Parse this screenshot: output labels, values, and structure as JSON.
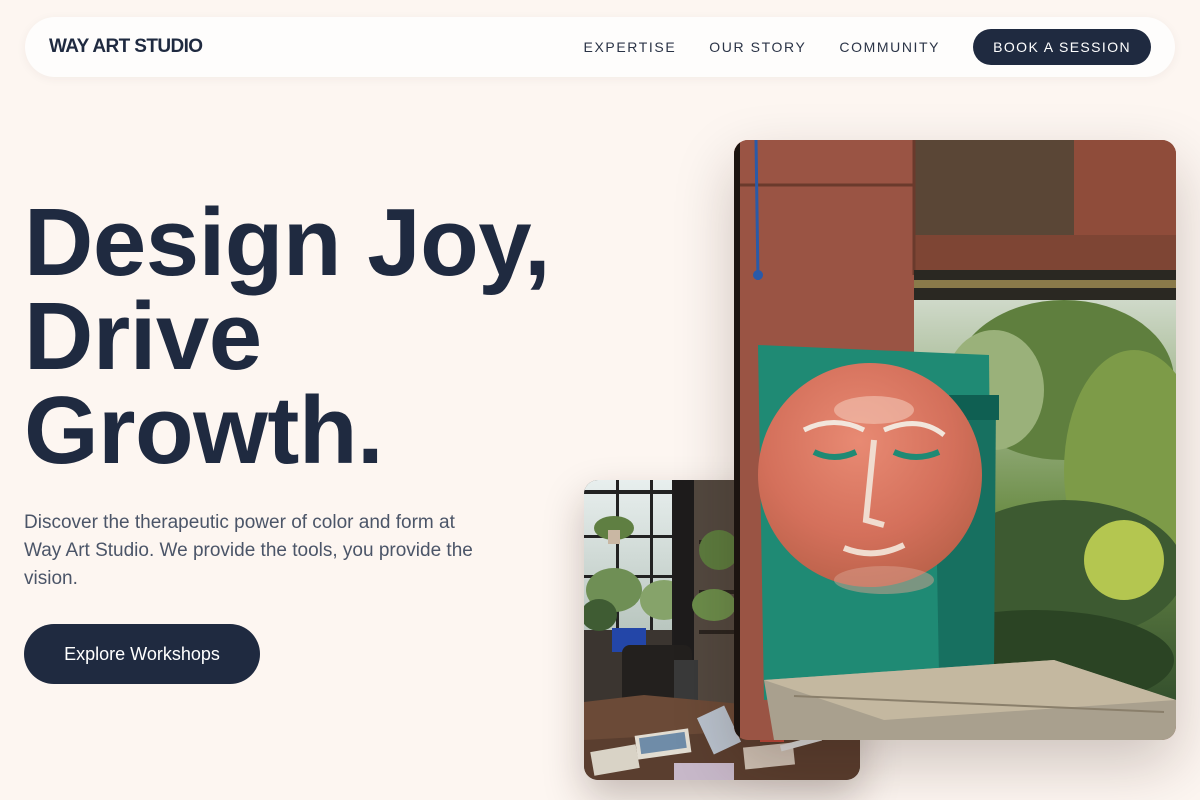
{
  "nav": {
    "logo": "WAY ART STUDIO",
    "links": [
      {
        "label": "EXPERTISE"
      },
      {
        "label": "OUR STORY"
      },
      {
        "label": "COMMUNITY"
      }
    ],
    "cta_label": "BOOK A SESSION"
  },
  "hero": {
    "headline_lines": [
      "Design Joy,",
      "Drive",
      "Growth."
    ],
    "lead": "Discover the therapeutic power of color and form at Way Art Studio. We provide the tools, you provide the vision.",
    "cta_label": "Explore Workshops"
  },
  "colors": {
    "background": "#fdf6f1",
    "navy": "#1f2a40",
    "body_text": "#4b5568"
  }
}
